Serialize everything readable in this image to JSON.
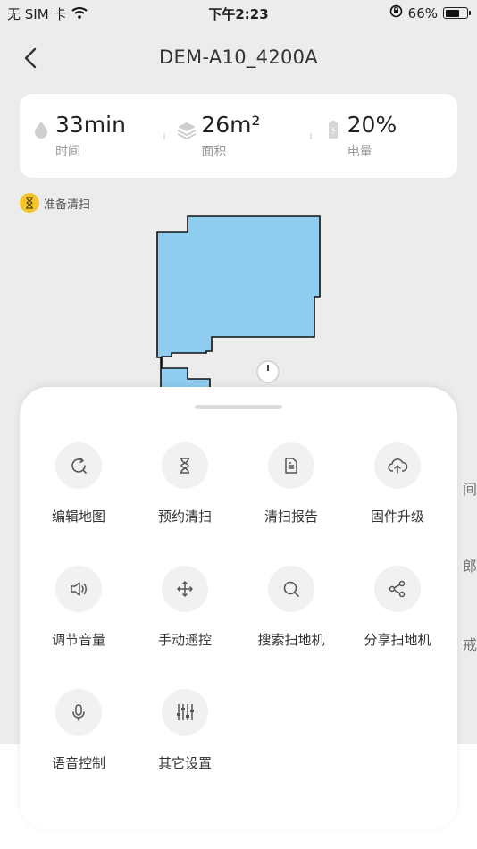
{
  "status_bar": {
    "carrier": "无 SIM 卡",
    "time": "下午2:23",
    "battery": "66%",
    "battery_level": 0.66
  },
  "header": {
    "title": "DEM-A10_4200A"
  },
  "stats": [
    {
      "value": "33min",
      "label": "时间",
      "icon": "water-drop-icon"
    },
    {
      "value": "26m²",
      "label": "面积",
      "icon": "layers-icon"
    },
    {
      "value": "20%",
      "label": "电量",
      "icon": "battery-icon"
    }
  ],
  "robot_status": {
    "text": "准备清扫",
    "color": "#f3c42c"
  },
  "map": {
    "fill_color": "#8fcdf0",
    "outline_color": "#111111"
  },
  "menu": [
    {
      "label": "编辑地图",
      "icon": "edit-map-icon"
    },
    {
      "label": "预约清扫",
      "icon": "hourglass-icon"
    },
    {
      "label": "清扫报告",
      "icon": "report-icon"
    },
    {
      "label": "固件升级",
      "icon": "cloud-upload-icon"
    },
    {
      "label": "调节音量",
      "icon": "volume-icon"
    },
    {
      "label": "手动遥控",
      "icon": "move-icon"
    },
    {
      "label": "搜索扫地机",
      "icon": "search-icon"
    },
    {
      "label": "分享扫地机",
      "icon": "share-icon"
    },
    {
      "label": "语音控制",
      "icon": "microphone-icon"
    },
    {
      "label": "其它设置",
      "icon": "sliders-icon"
    }
  ]
}
